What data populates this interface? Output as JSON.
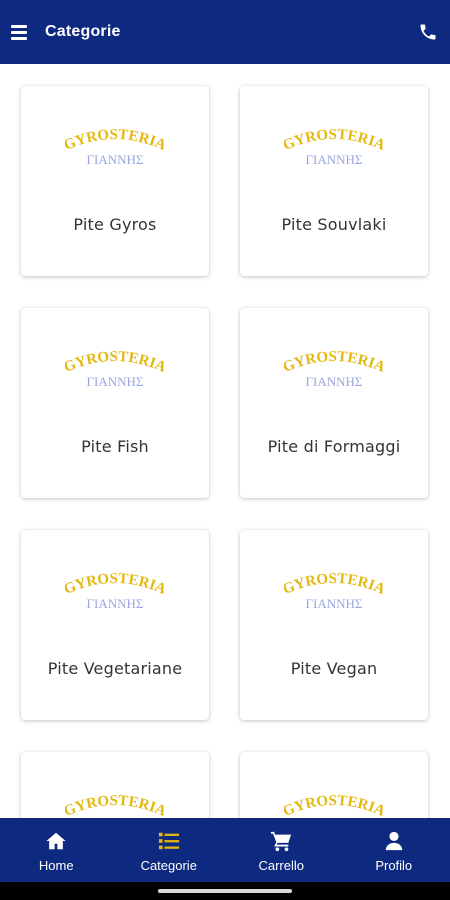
{
  "appbar": {
    "title": "Categorie",
    "menu_icon": "menu-icon",
    "phone_icon": "phone-icon",
    "background": "#0e2a80"
  },
  "logo": {
    "line1": "GYROSTERIA",
    "line2": "ΓΙΑΝΝΗΣ",
    "color_line1": "#e4b80f",
    "color_line2": "#9aa6e0"
  },
  "categories": [
    {
      "label": "Pite Gyros"
    },
    {
      "label": "Pite Souvlaki"
    },
    {
      "label": "Pite Fish"
    },
    {
      "label": "Pite di Formaggi"
    },
    {
      "label": "Pite Vegetariane"
    },
    {
      "label": "Pite Vegan"
    },
    {
      "label": ""
    },
    {
      "label": ""
    }
  ],
  "bottom_nav": [
    {
      "label": "Home",
      "icon": "home-icon"
    },
    {
      "label": "Categorie",
      "icon": "list-icon",
      "active": true
    },
    {
      "label": "Carrello",
      "icon": "cart-icon"
    },
    {
      "label": "Profilo",
      "icon": "user-icon"
    }
  ],
  "colors": {
    "primary": "#0e2a80",
    "active_icon": "#e4b80f",
    "card_text": "#333333"
  }
}
